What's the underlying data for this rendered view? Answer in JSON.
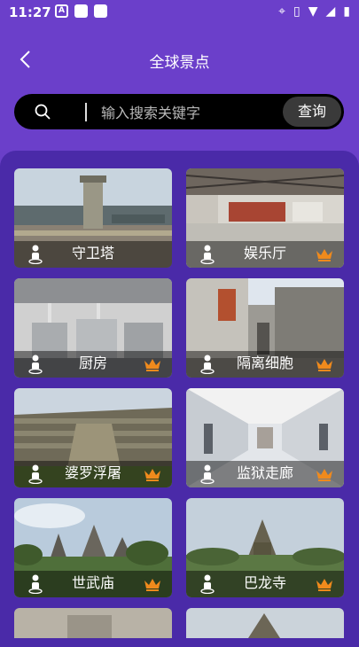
{
  "status": {
    "time": "11:27",
    "badge": "A"
  },
  "header": {
    "title": "全球景点"
  },
  "search": {
    "placeholder": "输入搜索关键字",
    "button": "查询"
  },
  "cards": [
    {
      "label": "守卫塔",
      "vip": false
    },
    {
      "label": "娱乐厅",
      "vip": true
    },
    {
      "label": "厨房",
      "vip": true
    },
    {
      "label": "隔离细胞",
      "vip": true
    },
    {
      "label": "婆罗浮屠",
      "vip": true
    },
    {
      "label": "监狱走廊",
      "vip": true
    },
    {
      "label": "世武庙",
      "vip": true
    },
    {
      "label": "巴龙寺",
      "vip": true
    }
  ],
  "colors": {
    "accent": "#6b3fca",
    "panel": "#4a2aa8",
    "crown": "#f08a1c"
  }
}
